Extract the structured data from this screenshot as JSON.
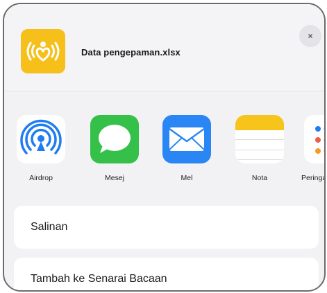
{
  "header": {
    "file_name": "Data pengepaman.xlsx",
    "close_label": "×",
    "app_icon": "heart-signal-icon",
    "app_icon_color": "#f6bf1a"
  },
  "share_targets": [
    {
      "label": "Airdrop",
      "icon": "airdrop-icon"
    },
    {
      "label": "Mesej",
      "icon": "message-bubble-icon"
    },
    {
      "label": "Mel",
      "icon": "mail-envelope-icon"
    },
    {
      "label": "Nota",
      "icon": "notes-icon"
    },
    {
      "label": "Peringa",
      "icon": "reminders-icon"
    }
  ],
  "actions": [
    {
      "label": "Salinan"
    },
    {
      "label": "Tambah ke Senarai Bacaan"
    }
  ]
}
